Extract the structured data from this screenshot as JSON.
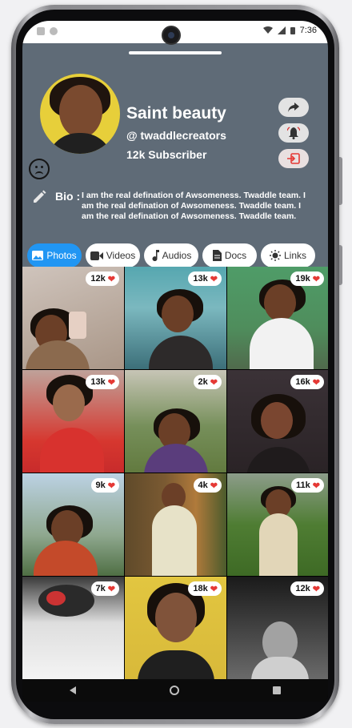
{
  "status_bar": {
    "time": "7:36"
  },
  "profile": {
    "name": "Saint beauty",
    "handle": "@ twaddlecreators",
    "subscribers": "12k Subscriber",
    "bio_label": "Bio :",
    "bio_text": "I am the real defination of Awsomeness. Twaddle team. I am the real defination of Awsomeness. Twaddle team. I am the real defination of Awsomeness. Twaddle team."
  },
  "actions": [
    {
      "name": "share",
      "icon": "share-icon"
    },
    {
      "name": "notify",
      "icon": "bell-icon"
    },
    {
      "name": "exit",
      "icon": "exit-icon"
    }
  ],
  "tabs": [
    {
      "label": "Photos",
      "icon": "image-icon",
      "active": true
    },
    {
      "label": "Videos",
      "icon": "video-icon",
      "active": false
    },
    {
      "label": "Audios",
      "icon": "music-icon",
      "active": false
    },
    {
      "label": "Docs",
      "icon": "doc-icon",
      "active": false
    },
    {
      "label": "Links",
      "icon": "sun-icon",
      "active": false
    }
  ],
  "photos": [
    {
      "likes": "12k"
    },
    {
      "likes": "13k"
    },
    {
      "likes": "19k"
    },
    {
      "likes": "13k"
    },
    {
      "likes": "2k"
    },
    {
      "likes": "16k"
    },
    {
      "likes": "9k"
    },
    {
      "likes": "4k"
    },
    {
      "likes": "11k"
    },
    {
      "likes": "7k"
    },
    {
      "likes": "18k"
    },
    {
      "likes": "12k"
    }
  ],
  "colors": {
    "sheet_bg": "#5f6b77",
    "tab_active": "#2196f3",
    "heart": "#e53935"
  }
}
